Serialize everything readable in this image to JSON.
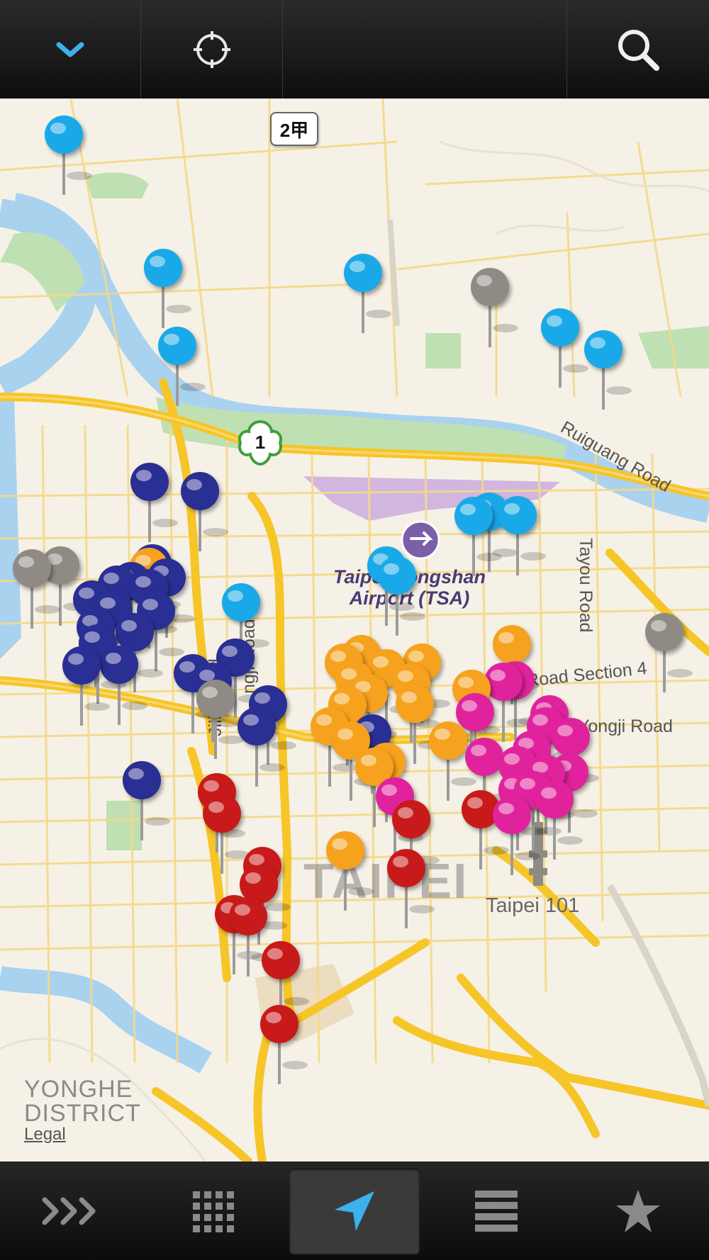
{
  "toolbar": {
    "collapse_icon": "chevron-down-icon",
    "locate_icon": "crosshair-icon",
    "search_icon": "search-icon",
    "accent": "#3db1ee"
  },
  "map": {
    "route_shield_2": "2甲",
    "route_shield_1": "1",
    "airport_label_line1": "Taipei Songshan",
    "airport_label_line2": "Airport (TSA)",
    "city_label": "TAIPEI",
    "landmark_label": "Taipei 101",
    "district_label_line1": "YONGHE",
    "district_label_line2": "DISTRICT",
    "legal_link": "Legal",
    "road_labels": {
      "ruiguang": "Ruiguang Road",
      "tayou": "Tayou Road",
      "section4": "e Road Section 4",
      "yongji": "Yongji Road",
      "jilin": "Jilin Road",
      "songjiang": "ngji Road"
    },
    "pin_colors": {
      "cyan": "#1aa9e8",
      "navy": "#2a2f93",
      "orange": "#f6a21e",
      "magenta": "#e0239c",
      "red": "#c81a1a",
      "gray": "#8f8b84"
    }
  },
  "tabbar": {
    "items": [
      {
        "icon": "triple-chevron-icon"
      },
      {
        "icon": "grid-icon"
      },
      {
        "icon": "location-arrow-icon",
        "active": true
      },
      {
        "icon": "list-icon"
      },
      {
        "icon": "star-icon"
      }
    ]
  }
}
